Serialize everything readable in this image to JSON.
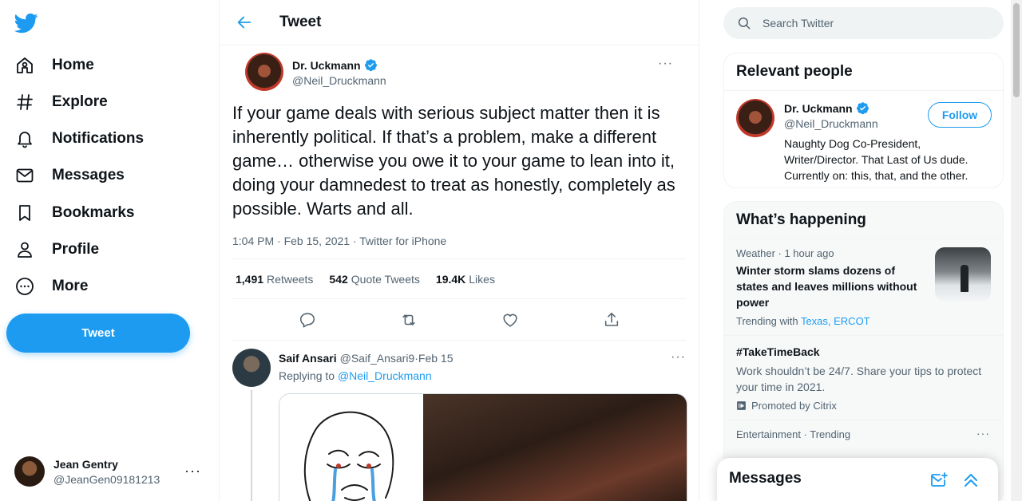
{
  "brand": {
    "accent": "#1d9bf0",
    "text": "#0f1419",
    "muted": "#536471",
    "logo_icon": "twitter-bird-icon"
  },
  "nav": {
    "items": [
      {
        "label": "Home",
        "icon": "home-icon"
      },
      {
        "label": "Explore",
        "icon": "hashtag-icon"
      },
      {
        "label": "Notifications",
        "icon": "bell-icon"
      },
      {
        "label": "Messages",
        "icon": "envelope-icon"
      },
      {
        "label": "Bookmarks",
        "icon": "bookmark-icon"
      },
      {
        "label": "Profile",
        "icon": "person-icon"
      },
      {
        "label": "More",
        "icon": "more-circle-icon"
      }
    ],
    "tweet_button": "Tweet"
  },
  "account": {
    "name": "Jean Gentry",
    "handle": "@JeanGen09181213",
    "more": "···"
  },
  "main": {
    "header_title": "Tweet",
    "tweet": {
      "author_name": "Dr. Uckmann",
      "author_handle": "@Neil_Druckmann",
      "more": "···",
      "text": "If your game deals with serious subject matter then it is inherently political. If that’s a problem, make a different game… otherwise you owe it to your game to lean into it, doing your damnedest to treat as honestly, completely as possible. Warts and all.",
      "timestamp": "1:04 PM · Feb 15, 2021 · ",
      "source": "Twitter for iPhone",
      "stats": {
        "retweets_count": "1,491",
        "retweets_label": "Retweets",
        "quotes_count": "542",
        "quotes_label": "Quote Tweets",
        "likes_count": "19.4K",
        "likes_label": "Likes"
      }
    },
    "reply": {
      "name": "Saif Ansari",
      "handle": "@Saif_Ansari9",
      "separator": " · ",
      "date": "Feb 15",
      "replying_prefix": "Replying to ",
      "replying_to": "@Neil_Druckmann",
      "more": "···"
    }
  },
  "search": {
    "placeholder": "Search Twitter"
  },
  "relevant": {
    "title": "Relevant people",
    "person": {
      "name": "Dr. Uckmann",
      "handle": "@Neil_Druckmann",
      "follow_label": "Follow",
      "bio": "Naughty Dog Co-President, Writer/Director. That Last of Us dude. Currently on: this, that, and the other."
    }
  },
  "happening": {
    "title": "What’s happening",
    "trends": [
      {
        "meta": "Weather · 1 hour ago",
        "title": "Winter storm slams dozens of states and leaves millions without power",
        "with_prefix": "Trending with ",
        "with_links": "Texas, ERCOT"
      },
      {
        "title": "#TakeTimeBack",
        "desc": "Work shouldn’t be 24/7. Share your tips to protect your time in 2021.",
        "promo": "Promoted by Citrix"
      },
      {
        "meta": "Entertainment · Trending",
        "more": "···"
      }
    ]
  },
  "messages_drawer": {
    "title": "Messages"
  }
}
